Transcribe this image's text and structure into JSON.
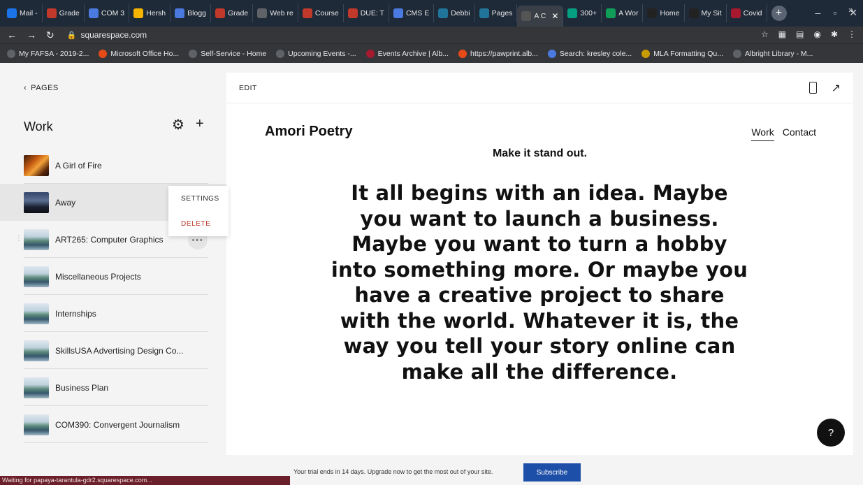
{
  "browser": {
    "tabs": [
      {
        "label": "Mail -",
        "fav": "#1a73e8",
        "icon": "mail-icon"
      },
      {
        "label": "Grade",
        "fav": "#c0392b",
        "icon": "grade-icon"
      },
      {
        "label": "COM 3",
        "fav": "#4a7ae0",
        "icon": "docs-icon"
      },
      {
        "label": "Hersh",
        "fav": "#f4b400",
        "icon": "slides-icon"
      },
      {
        "label": "Blogg",
        "fav": "#4a7ae0",
        "icon": "docs-icon"
      },
      {
        "label": "Grade",
        "fav": "#c0392b",
        "icon": "grade-icon"
      },
      {
        "label": "Web re",
        "fav": "#5f6368",
        "icon": "globe-icon"
      },
      {
        "label": "Course",
        "fav": "#c0392b",
        "icon": "grade-icon"
      },
      {
        "label": "DUE: T",
        "fav": "#c0392b",
        "icon": "grade-icon"
      },
      {
        "label": "CMS E",
        "fav": "#4a7ae0",
        "icon": "docs-icon"
      },
      {
        "label": "Debbi",
        "fav": "#21759b",
        "icon": "wordpress-icon"
      },
      {
        "label": "Pages",
        "fav": "#21759b",
        "icon": "wordpress-icon"
      },
      {
        "label": "A C",
        "fav": "#555555",
        "icon": "squarespace-icon",
        "active": true
      },
      {
        "label": "300+",
        "fav": "#05a081",
        "icon": "pexels-icon"
      },
      {
        "label": "A Wor",
        "fav": "#0f9d58",
        "icon": "drive-icon"
      },
      {
        "label": "Home",
        "fav": "#222222",
        "icon": "wix-icon"
      },
      {
        "label": "My Sit",
        "fav": "#222222",
        "icon": "wix-icon"
      },
      {
        "label": "Covid",
        "fav": "#a6192e",
        "icon": "shield-icon"
      }
    ],
    "url": "squarespace.com",
    "bookmarks": [
      {
        "label": "My FAFSA - 2019-2...",
        "fav": "#5f6368"
      },
      {
        "label": "Microsoft Office Ho...",
        "fav": "#e64a19"
      },
      {
        "label": "Self-Service - Home",
        "fav": "#5f6368"
      },
      {
        "label": "Upcoming Events -...",
        "fav": "#5f6368"
      },
      {
        "label": "Events Archive | Alb...",
        "fav": "#a6192e"
      },
      {
        "label": "https://pawprint.alb...",
        "fav": "#e64a19"
      },
      {
        "label": "Search: kresley cole...",
        "fav": "#4a7ae0"
      },
      {
        "label": "MLA Formatting Qu...",
        "fav": "#c79a00"
      },
      {
        "label": "Albright Library - M...",
        "fav": "#5f6368"
      }
    ],
    "bookmarks_more": "»",
    "status_text": "Waiting for papaya-tarantula-gdr2.squarespace.com..."
  },
  "sidebar": {
    "back_label": "PAGES",
    "section_title": "Work",
    "pages": [
      {
        "label": "A Girl of Fire",
        "thumb": "fire"
      },
      {
        "label": "Away",
        "thumb": "away",
        "selected": true
      },
      {
        "label": "ART265: Computer Graphics",
        "thumb": "land",
        "hover": true
      },
      {
        "label": "Miscellaneous Projects",
        "thumb": "land"
      },
      {
        "label": "Internships",
        "thumb": "land"
      },
      {
        "label": "SkillsUSA Advertising Design Co...",
        "thumb": "land"
      },
      {
        "label": "Business Plan",
        "thumb": "land"
      },
      {
        "label": "COM390: Convergent Journalism",
        "thumb": "land"
      }
    ],
    "context_menu": {
      "settings": "SETTINGS",
      "delete": "DELETE"
    }
  },
  "preview": {
    "edit_label": "EDIT",
    "site_title": "Amori Poetry",
    "nav": {
      "work": "Work",
      "contact": "Contact"
    },
    "tagline": "Make it stand out.",
    "hero": "It all begins with an idea. Maybe you want to launch a business. Maybe you want to turn a hobby into something more. Or maybe you have a creative project to share with the world. Whatever it is, the way you tell your story online can make all the difference.",
    "help_label": "?"
  },
  "banner": {
    "trial_text": "Your trial ends in 14 days. Upgrade now to get the most out of your site.",
    "subscribe_label": "Subscribe"
  }
}
